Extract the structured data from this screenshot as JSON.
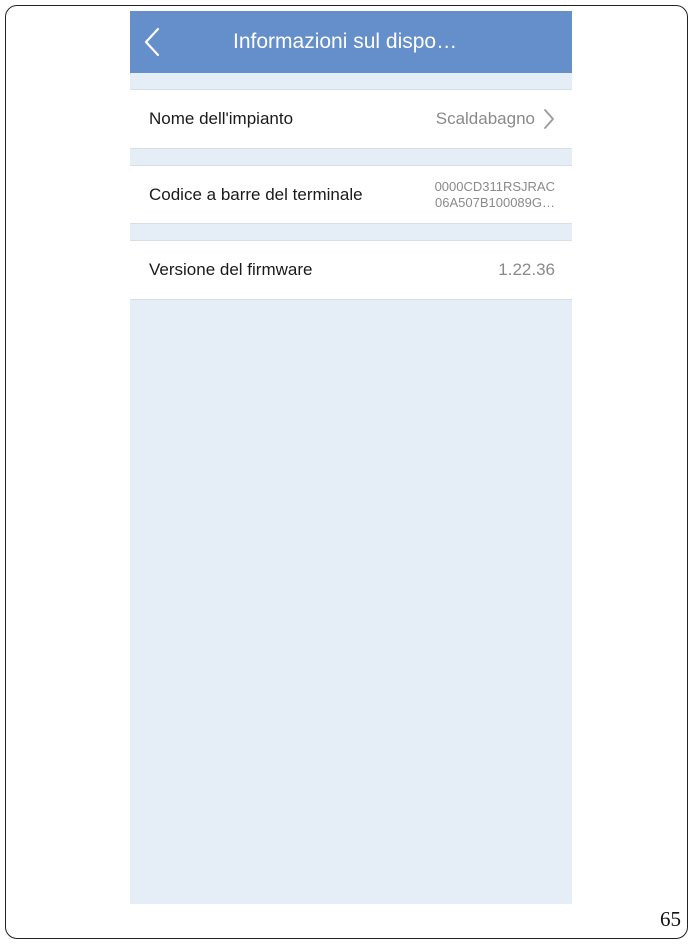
{
  "header": {
    "title": "Informazioni sul dispo…"
  },
  "rows": [
    {
      "label": "Nome dell'impianto",
      "value": "Scaldabagno"
    },
    {
      "label": "Codice a barre del terminale",
      "value_line1": "0000CD311RSJRAC",
      "value_line2": "06A507B100089G…"
    },
    {
      "label": "Versione del firmware",
      "value": "1.22.36"
    }
  ],
  "icons": {
    "back": "chevron-left-icon",
    "row_arrow": "chevron-right-icon"
  },
  "colors": {
    "header": "#658fcb",
    "background": "#e5edf7"
  },
  "page_number": "65"
}
